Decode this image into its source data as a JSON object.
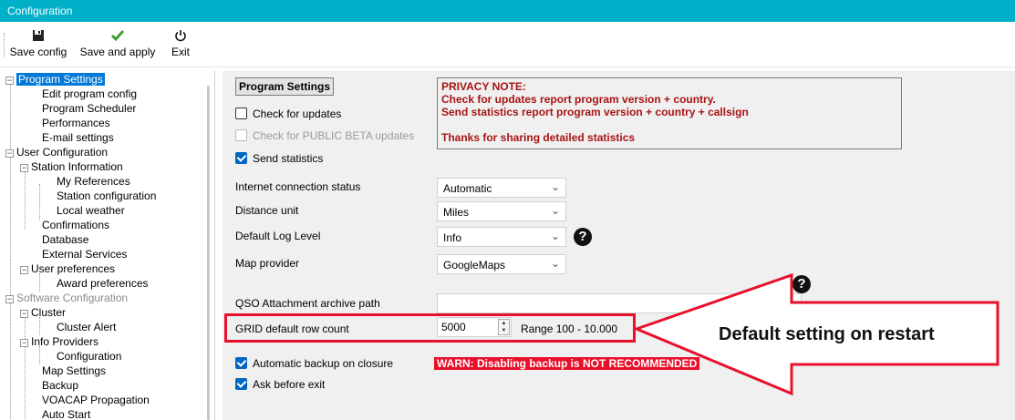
{
  "window": {
    "title": "Configuration"
  },
  "toolbar": {
    "save_config": "Save config",
    "save_and_apply": "Save and apply",
    "exit": "Exit",
    "save_icon": "floppy-disk-icon",
    "apply_icon": "green-check-icon",
    "exit_icon": "power-icon"
  },
  "tree": {
    "program_settings": "Program Settings",
    "edit_program_config": "Edit program config",
    "program_scheduler": "Program Scheduler",
    "performances": "Performances",
    "email_settings": "E-mail settings",
    "user_configuration": "User Configuration",
    "station_information": "Station Information",
    "my_references": "My References",
    "station_configuration": "Station configuration",
    "local_weather": "Local weather",
    "confirmations": "Confirmations",
    "database": "Database",
    "external_services": "External Services",
    "user_preferences": "User preferences",
    "award_preferences": "Award preferences",
    "software_configuration": "Software Configuration",
    "cluster": "Cluster",
    "cluster_alert": "Cluster Alert",
    "info_providers": "Info Providers",
    "configuration": "Configuration",
    "map_settings": "Map Settings",
    "backup": "Backup",
    "voacap": "VOACAP Propagation",
    "auto_start": "Auto Start"
  },
  "panel": {
    "section_title": "Program Settings",
    "privacy": {
      "title": "PRIVACY NOTE:",
      "line1": "Check for updates report program version + country.",
      "line2": "Send statistics report program version + country + callsign",
      "line3": "Thanks for sharing detailed statistics"
    },
    "check_updates": {
      "label": "Check for updates",
      "checked": false
    },
    "check_beta": {
      "label": "Check for PUBLIC BETA updates",
      "checked": false,
      "disabled": true
    },
    "send_statistics": {
      "label": "Send statistics",
      "checked": true
    },
    "internet_status": {
      "label": "Internet connection status",
      "value": "Automatic"
    },
    "distance_unit": {
      "label": "Distance unit",
      "value": "Miles"
    },
    "log_level": {
      "label": "Default Log Level",
      "value": "Info"
    },
    "map_provider": {
      "label": "Map provider",
      "value": "GoogleMaps"
    },
    "qso_path": {
      "label": "QSO Attachment archive path",
      "value": ""
    },
    "grid_rows": {
      "label": "GRID default row count",
      "value": "5000",
      "range": "Range 100 - 10.000"
    },
    "auto_backup": {
      "label": "Automatic backup on closure",
      "checked": true
    },
    "backup_warning": "WARN: Disabling backup is NOT RECOMMENDED",
    "ask_exit": {
      "label": "Ask before exit",
      "checked": true
    }
  },
  "callout": {
    "text": "Default setting on restart"
  },
  "colors": {
    "titlebar": "#00b0c8",
    "selection": "#0078d7",
    "highlight_red": "#e8102a",
    "privacy_text": "#a81414"
  }
}
